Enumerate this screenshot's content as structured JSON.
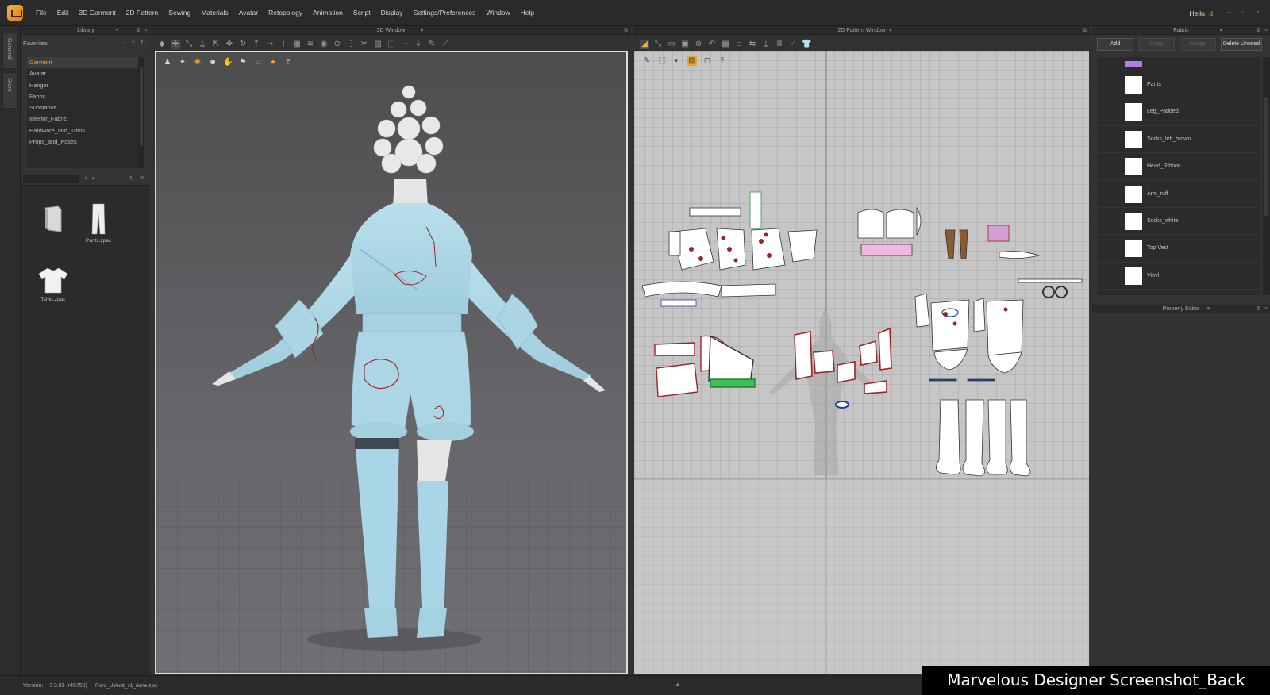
{
  "menubar": {
    "items": [
      "File",
      "Edit",
      "3D Garment",
      "2D Pattern",
      "Sewing",
      "Materials",
      "Avatar",
      "Retopology",
      "Animation",
      "Script",
      "Display",
      "Settings/Preferences",
      "Window",
      "Help"
    ],
    "greeting": "Hello,",
    "username": "d"
  },
  "side_tabs": [
    "General",
    "Store"
  ],
  "library": {
    "title": "Library",
    "favorites_label": "Favorites",
    "tree_items": [
      "Garment",
      "Avatar",
      "Hanger",
      "Fabric",
      "Substance",
      "Interior_Fabric",
      "Hardware_and_Trims",
      "Props_and_Poses"
    ],
    "search_placeholder": "",
    "files": [
      {
        "label": "..",
        "icon": "folder-icon"
      },
      {
        "label": "Pants.zpac",
        "icon": "pants-icon"
      },
      {
        "label": "Tshirt.zpac",
        "icon": "tshirt-icon"
      }
    ]
  },
  "window3d": {
    "title": "3D Window"
  },
  "window2d": {
    "title": "2D Pattern Window"
  },
  "fabric": {
    "title": "Fabric",
    "buttons": {
      "add": "Add",
      "copy": "Copy",
      "assign": "Assign",
      "delete_unused": "Delete Unused"
    },
    "items": [
      {
        "name": "",
        "color": "#b07fe0"
      },
      {
        "name": "Pants",
        "color": "#ffffff"
      },
      {
        "name": "Leg_Padded",
        "color": "#ffffff"
      },
      {
        "name": "Socks_left_brown",
        "color": "#ffffff"
      },
      {
        "name": "Head_Ribbon",
        "color": "#ffffff"
      },
      {
        "name": "Arm_ruff",
        "color": "#ffffff"
      },
      {
        "name": "Socks_white",
        "color": "#ffffff"
      },
      {
        "name": "Top Vest",
        "color": "#ffffff"
      },
      {
        "name": "Vinyl",
        "color": "#ffffff"
      }
    ]
  },
  "property_editor": {
    "title": "Property Editor"
  },
  "statusbar": {
    "version_label": "Version:",
    "version": "7.3.83 (r45759)",
    "file": "Roro_UVedit_v1_done.zprj"
  },
  "caption": "Marvelous Designer Screenshot_Back",
  "colors": {
    "accent": "#e9a034",
    "garment": "#a9d6e6",
    "seam": "#9c2424"
  }
}
